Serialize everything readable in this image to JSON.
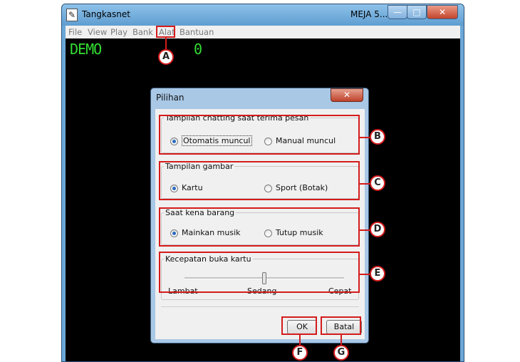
{
  "window": {
    "title": "Tangkasnet",
    "table": "MEJA 5...",
    "controls": {
      "minimize": "—",
      "maximize": "□",
      "close": "✕"
    }
  },
  "menu": [
    "File",
    "View",
    "Play",
    "Bank",
    "Alat",
    "Bantuan"
  ],
  "game": {
    "mode": "DEMO",
    "score": "0"
  },
  "dialog": {
    "title": "Pilihan",
    "close": "✕",
    "groups": [
      {
        "label": "Tampilan chatting saat terima pesan",
        "options": [
          {
            "label": "Otomatis muncul",
            "selected": true
          },
          {
            "label": "Manual muncul",
            "selected": false
          }
        ]
      },
      {
        "label": "Tampilan gambar",
        "options": [
          {
            "label": "Kartu",
            "selected": true
          },
          {
            "label": "Sport (Botak)",
            "selected": false
          }
        ]
      },
      {
        "label": "Saat kena barang",
        "options": [
          {
            "label": "Mainkan musik",
            "selected": true
          },
          {
            "label": "Tutup musik",
            "selected": false
          }
        ]
      }
    ],
    "speed": {
      "label": "Kecepatan buka kartu",
      "ticks": [
        "Lambat",
        "Sedang",
        "Cepat"
      ],
      "value": "Sedang"
    },
    "ok": "OK",
    "cancel": "Batal"
  },
  "callouts": [
    "A",
    "B",
    "C",
    "D",
    "E",
    "F",
    "G"
  ],
  "colors": {
    "highlight": "#d41c1c",
    "demo_text": "#33dd33",
    "titlebar": "#6aa8d8"
  }
}
